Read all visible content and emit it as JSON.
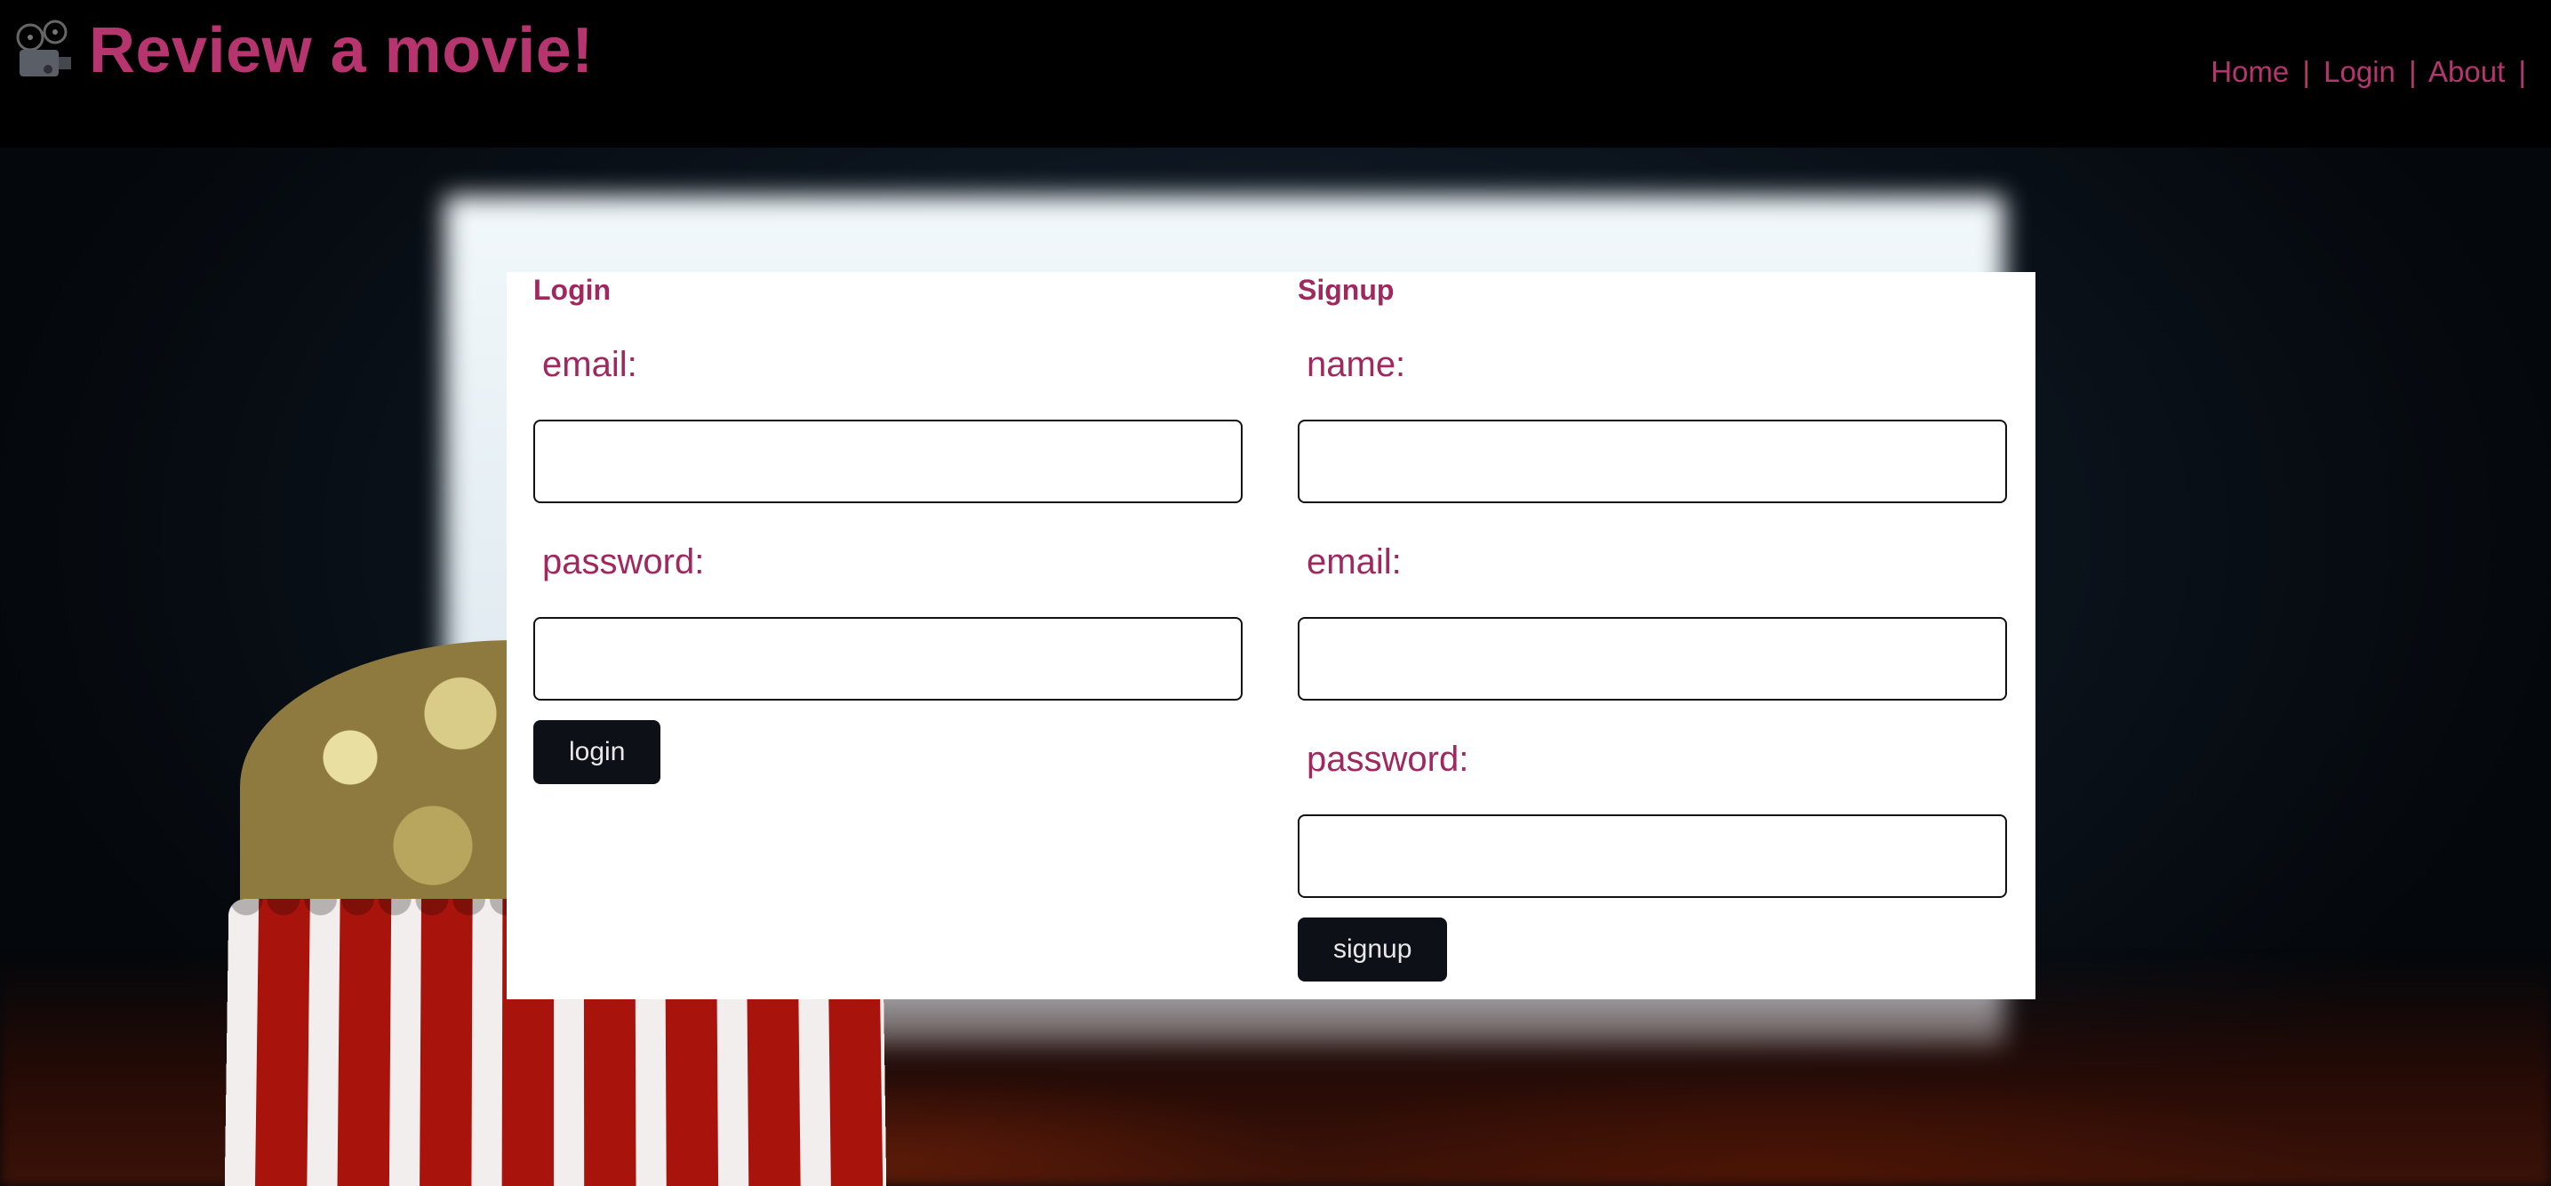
{
  "header": {
    "title": "Review a movie!",
    "logo_icon": "movie-projector-icon"
  },
  "nav": {
    "items": [
      "Home",
      "Login",
      "About"
    ],
    "separator": "|"
  },
  "login": {
    "title": "Login",
    "email_label": "email:",
    "password_label": "password:",
    "email_value": "",
    "password_value": "",
    "button_label": "login"
  },
  "signup": {
    "title": "Signup",
    "name_label": "name:",
    "email_label": "email:",
    "password_label": "password:",
    "name_value": "",
    "email_value": "",
    "password_value": "",
    "button_label": "signup"
  },
  "colors": {
    "accent": "#b7356f",
    "label": "#a0285e",
    "header_bg": "#000000",
    "button_bg": "#0d1117"
  }
}
